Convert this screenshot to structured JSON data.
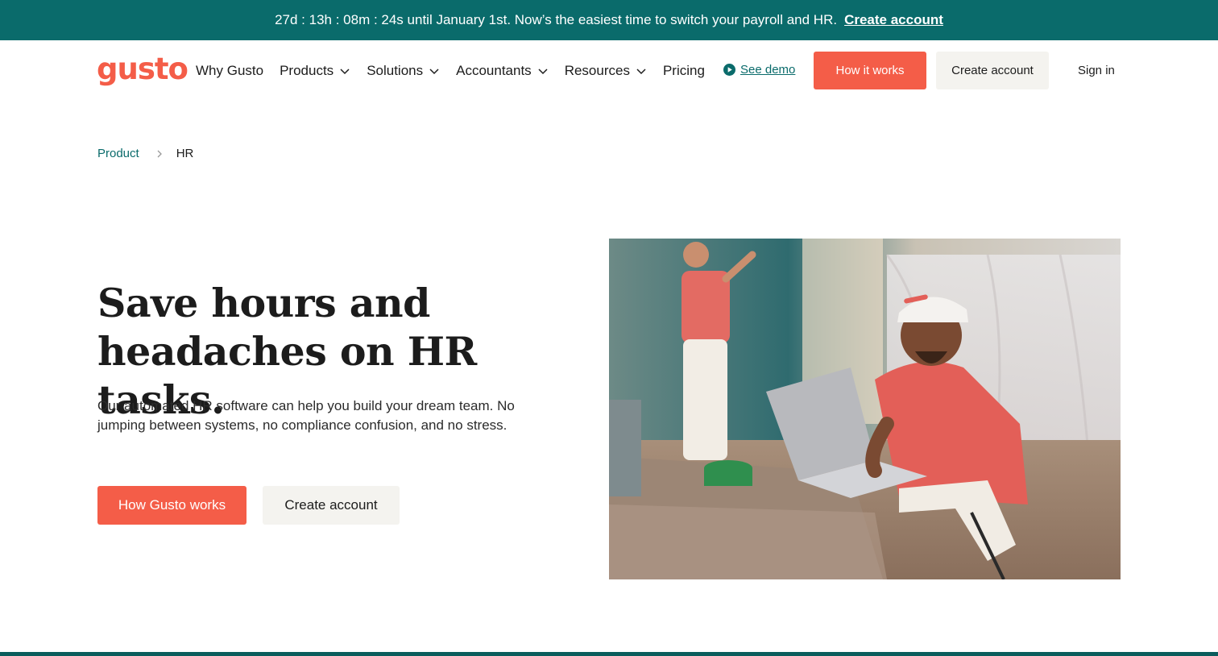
{
  "promo": {
    "text": "27d : 13h : 08m : 24s until January 1st. Now’s the easiest time to switch your payroll and HR.",
    "link": "Create account"
  },
  "header": {
    "logo": "gusto",
    "nav": [
      {
        "label": "Why Gusto",
        "dropdown": false
      },
      {
        "label": "Products",
        "dropdown": true
      },
      {
        "label": "Solutions",
        "dropdown": true
      },
      {
        "label": "Accountants",
        "dropdown": true
      },
      {
        "label": "Resources",
        "dropdown": true
      },
      {
        "label": "Pricing",
        "dropdown": false
      }
    ],
    "demo": "See demo",
    "how_it_works": "How it works",
    "create_account": "Create account",
    "sign_in": "Sign in"
  },
  "breadcrumb": {
    "parent": "Product",
    "current": "HR"
  },
  "hero": {
    "title_line1": "Save hours and",
    "title_line2": "headaches on HR tasks.",
    "body": "Our automated HR software can help you build your dream team. No jumping between systems, no compliance confusion, and no stress.",
    "primary_cta": "How Gusto works",
    "secondary_cta": "Create account"
  },
  "colors": {
    "brand": "#f45d48",
    "teal": "#0a6b6b",
    "light_button": "#f4f3ef"
  }
}
